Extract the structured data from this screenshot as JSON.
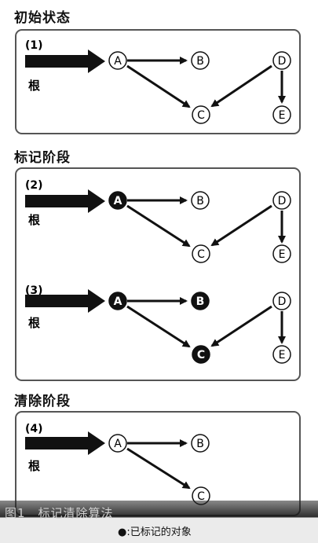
{
  "sections": {
    "initial": "初始状态",
    "mark": "标记阶段",
    "sweep": "清除阶段"
  },
  "panels": {
    "p1": {
      "label": "(1)",
      "root": "根"
    },
    "p2": {
      "label": "(2)",
      "root": "根"
    },
    "p3": {
      "label": "(3)",
      "root": "根"
    },
    "p4": {
      "label": "(4)",
      "root": "根"
    }
  },
  "nodes": {
    "A": "A",
    "B": "B",
    "C": "C",
    "D": "D",
    "E": "E"
  },
  "caption": "图1　标记清除算法",
  "legend": "●:已标记的对象",
  "colors": {
    "marked": "#111111",
    "unmarked": "#ffffff",
    "stroke": "#111111"
  }
}
